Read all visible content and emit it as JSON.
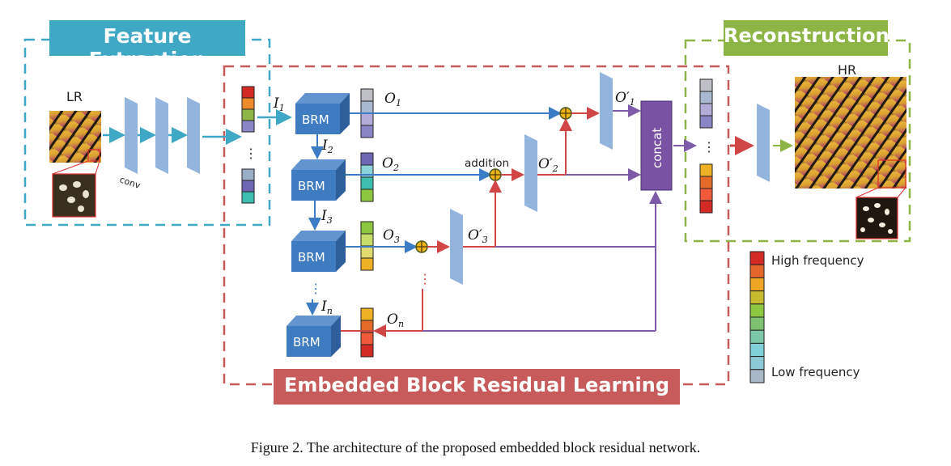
{
  "sections": {
    "feature_extraction": {
      "title": "Feature Extraction",
      "color": "#3FA8C4"
    },
    "embedded_block": {
      "title": "Embedded Block Residual Learning",
      "color": "#C75B5B"
    },
    "reconstruction": {
      "title": "Reconstruction",
      "color": "#8DB545"
    }
  },
  "labels": {
    "lr": "LR",
    "hr": "HR",
    "conv": "conv",
    "addition": "addition",
    "concat": "concat",
    "brm": "BRM",
    "ellipsis": "⋮"
  },
  "brm_blocks": [
    {
      "input": "I",
      "input_sub": "1",
      "output": "O",
      "output_sub": "1"
    },
    {
      "input": "I",
      "input_sub": "2",
      "output": "O",
      "output_sub": "2"
    },
    {
      "input": "I",
      "input_sub": "3",
      "output": "O",
      "output_sub": "3"
    },
    {
      "input": "I",
      "input_sub": "n",
      "output": "O",
      "output_sub": "n"
    }
  ],
  "refined_outputs": [
    {
      "label": "O′",
      "sub": "1"
    },
    {
      "label": "O′",
      "sub": "2"
    },
    {
      "label": "O′",
      "sub": "3"
    }
  ],
  "legend": {
    "high": "High frequency",
    "low": "Low frequency",
    "colors": [
      "#D42A26",
      "#E5662A",
      "#EEA524",
      "#C8BA2E",
      "#8DC63F",
      "#7DC26E",
      "#7CC7A6",
      "#7FD0D8",
      "#8BCAD6",
      "#A8B8C8"
    ]
  },
  "colors": {
    "blue_line": "#3B7CC4",
    "red_line": "#D04545",
    "purple_line": "#7E5BA8",
    "green_line": "#8DB545",
    "cyan_line": "#3FA8C4",
    "conv_fill": "#93B4DD",
    "brm_fill": "#3F7BC1",
    "concat_fill": "#7A52A3",
    "adder_fill": "#F2B416"
  },
  "caption": "Figure 2. The architecture of the proposed embedded block residual network."
}
